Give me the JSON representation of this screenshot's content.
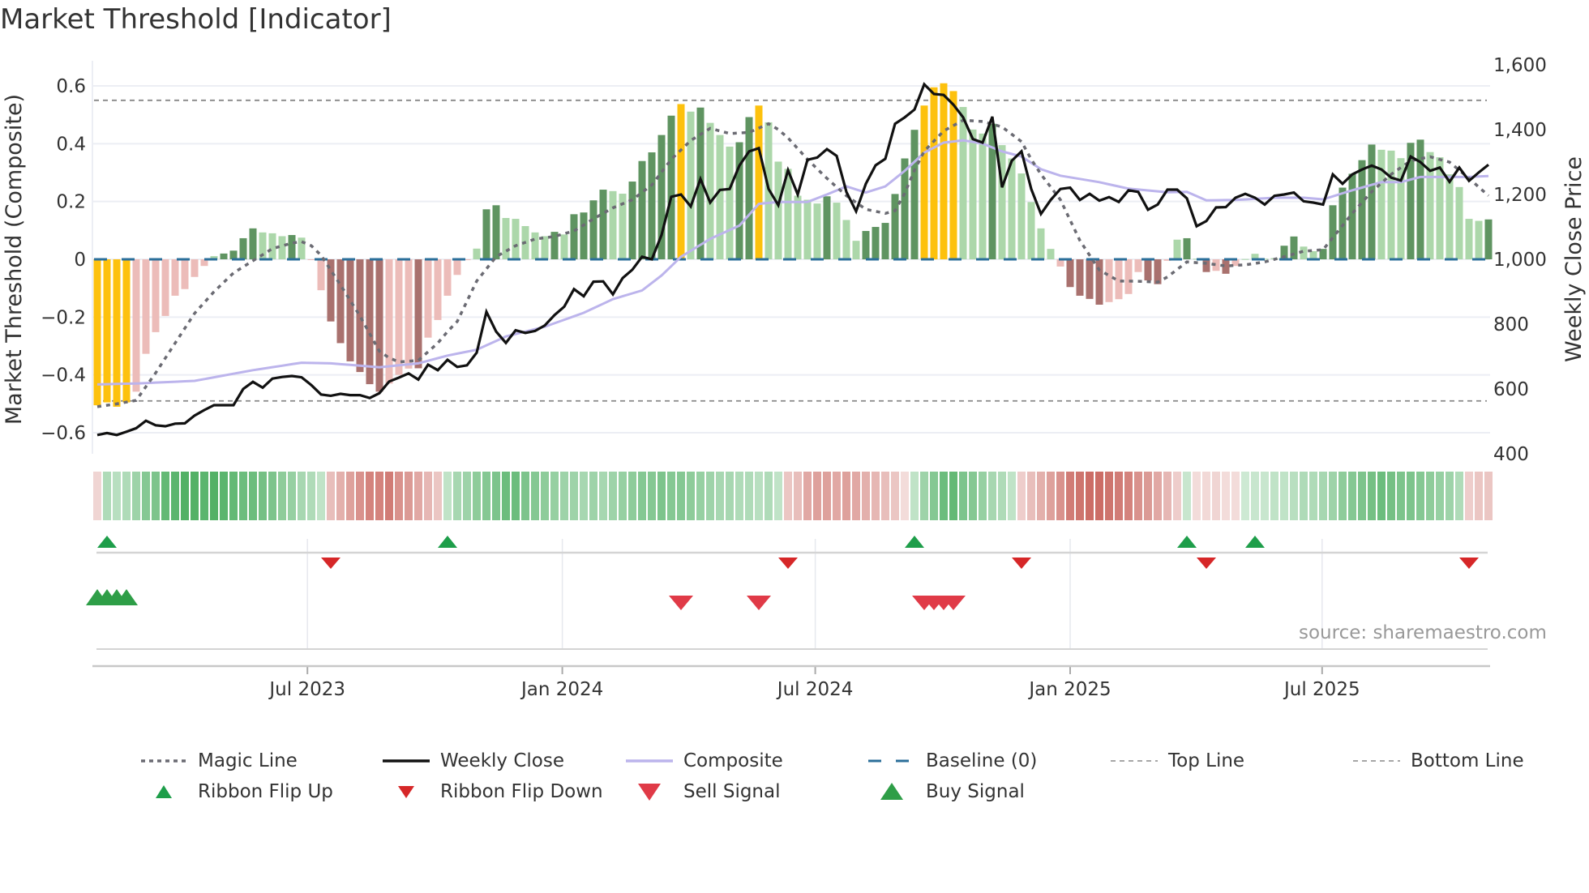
{
  "title": "Market Threshold [Indicator]",
  "source": "source: sharemaestro.com",
  "legend": [
    {
      "label": "Magic Line",
      "symbol": "dotted-line",
      "color": "#6b6b73"
    },
    {
      "label": "Weekly Close",
      "symbol": "solid-line",
      "color": "#111111"
    },
    {
      "label": "Composite",
      "symbol": "solid-line",
      "color": "#bcb4ec"
    },
    {
      "label": "Baseline (0)",
      "symbol": "dashed-line",
      "color": "#2b6f9a"
    },
    {
      "label": "Top Line",
      "symbol": "thin-dashed-line",
      "color": "#888888"
    },
    {
      "label": "Bottom Line",
      "symbol": "thin-dashed-line",
      "color": "#888888"
    },
    {
      "label": "Ribbon Flip Up",
      "symbol": "triangle-up",
      "color": "#1e9e4a"
    },
    {
      "label": "Ribbon Flip Down",
      "symbol": "triangle-down",
      "color": "#d62728"
    },
    {
      "label": "Sell Signal",
      "symbol": "triangle-down-large",
      "color": "#e03a47"
    },
    {
      "label": "Buy Signal",
      "symbol": "triangle-up-large",
      "color": "#2e9e47"
    }
  ],
  "chart_data": {
    "type": "bar",
    "title": "Market Threshold [Indicator]",
    "ylabel": "Market Threshold (Composite)",
    "y2label": "Weekly Close Price",
    "ylim": [
      -0.66,
      0.7
    ],
    "y2lim": [
      400,
      1600
    ],
    "yticks": [
      -0.6,
      -0.4,
      -0.2,
      0,
      0.2,
      0.4,
      0.6
    ],
    "ytick_labels": [
      "−0.6",
      "−0.4",
      "−0.2",
      "0",
      "0.2",
      "0.4",
      "0.6"
    ],
    "y2ticks": [
      400,
      600,
      800,
      1000,
      1200,
      1400,
      1600
    ],
    "y2tick_labels": [
      "400",
      "600",
      "800",
      "1,000",
      "1,200",
      "1,400",
      "1,600"
    ],
    "xticks": [
      {
        "label": "Jul 2023",
        "week_index": 21.6
      },
      {
        "label": "Jan 2024",
        "week_index": 47.8
      },
      {
        "label": "Jul 2024",
        "week_index": 73.8
      },
      {
        "label": "Jan 2025",
        "week_index": 100.0
      },
      {
        "label": "Jul 2025",
        "week_index": 125.9
      }
    ],
    "grid": true,
    "legend_position": "bottom",
    "top_line": 0.55,
    "bottom_line": -0.49,
    "baseline": 0,
    "colors": {
      "Y": "#fdc10d",
      "DG": "#5f9461",
      "LG": "#acd7aa",
      "DR": "#a9716e",
      "LR": "#ecbcb9",
      "ribbon_pos": "#3aa650",
      "ribbon_neg": "#c4574f"
    },
    "composite_bars": [
      -0.505,
      -0.495,
      -0.51,
      -0.495,
      -0.458,
      -0.327,
      -0.252,
      -0.196,
      -0.126,
      -0.103,
      -0.061,
      -0.023,
      0.011,
      0.02,
      0.03,
      0.073,
      0.107,
      0.093,
      0.09,
      0.08,
      0.084,
      0.075,
      -0.002,
      -0.107,
      -0.215,
      -0.29,
      -0.353,
      -0.39,
      -0.432,
      -0.458,
      -0.43,
      -0.4,
      -0.378,
      -0.377,
      -0.271,
      -0.21,
      -0.126,
      -0.054,
      -0.003,
      0.037,
      0.173,
      0.187,
      0.143,
      0.14,
      0.115,
      0.093,
      0.08,
      0.095,
      0.086,
      0.156,
      0.162,
      0.204,
      0.241,
      0.236,
      0.227,
      0.269,
      0.34,
      0.37,
      0.43,
      0.497,
      0.537,
      0.511,
      0.525,
      0.472,
      0.43,
      0.39,
      0.405,
      0.492,
      0.532,
      0.474,
      0.338,
      0.313,
      0.22,
      0.206,
      0.193,
      0.218,
      0.196,
      0.136,
      0.064,
      0.098,
      0.112,
      0.126,
      0.226,
      0.349,
      0.448,
      0.532,
      0.595,
      0.609,
      0.582,
      0.527,
      0.449,
      0.435,
      0.469,
      0.395,
      0.349,
      0.297,
      0.198,
      0.107,
      0.036,
      -0.025,
      -0.096,
      -0.126,
      -0.137,
      -0.157,
      -0.148,
      -0.138,
      -0.12,
      -0.044,
      -0.073,
      -0.086,
      -0.005,
      0.068,
      0.073,
      0.002,
      -0.044,
      -0.04,
      -0.05,
      -0.023,
      0.001,
      0.019,
      0.002,
      0.004,
      0.047,
      0.079,
      0.044,
      0.028,
      0.036,
      0.187,
      0.248,
      0.296,
      0.343,
      0.397,
      0.379,
      0.376,
      0.35,
      0.403,
      0.414,
      0.371,
      0.353,
      0.294,
      0.25,
      0.14,
      0.133,
      0.138
    ],
    "bar_classes": [
      "Y",
      "Y",
      "Y",
      "Y",
      "LR",
      "LR",
      "LR",
      "LR",
      "LR",
      "LR",
      "LR",
      "LR",
      "LG",
      "DG",
      "DG",
      "DG",
      "DG",
      "LG",
      "LG",
      "LG",
      "DG",
      "LG",
      "LR",
      "LR",
      "DR",
      "DR",
      "DR",
      "DR",
      "DR",
      "DR",
      "LR",
      "LR",
      "LR",
      "DR",
      "LR",
      "LR",
      "LR",
      "LR",
      "LR",
      "LG",
      "DG",
      "DG",
      "LG",
      "LG",
      "LG",
      "LG",
      "LG",
      "DG",
      "LG",
      "DG",
      "DG",
      "DG",
      "DG",
      "LG",
      "LG",
      "DG",
      "DG",
      "DG",
      "DG",
      "DG",
      "Y",
      "LG",
      "DG",
      "LG",
      "LG",
      "LG",
      "DG",
      "DG",
      "Y",
      "LG",
      "LG",
      "LG",
      "LG",
      "LG",
      "LG",
      "DG",
      "LG",
      "LG",
      "LG",
      "DG",
      "DG",
      "DG",
      "DG",
      "DG",
      "DG",
      "Y",
      "Y",
      "Y",
      "Y",
      "LG",
      "LG",
      "LG",
      "DG",
      "LG",
      "LG",
      "LG",
      "LG",
      "LG",
      "LG",
      "LR",
      "DR",
      "DR",
      "DR",
      "DR",
      "LR",
      "LR",
      "LR",
      "LR",
      "DR",
      "DR",
      "LR",
      "LG",
      "DG",
      "LG",
      "DR",
      "LR",
      "DR",
      "LR",
      "LG",
      "LG",
      "LG",
      "LG",
      "DG",
      "DG",
      "LG",
      "LG",
      "DG",
      "DG",
      "DG",
      "DG",
      "DG",
      "DG",
      "LG",
      "LG",
      "LG",
      "DG",
      "DG",
      "LG",
      "LG",
      "LG",
      "LG",
      "LG",
      "LG",
      "DG"
    ],
    "weekly_close": [
      458,
      464,
      458,
      468,
      479,
      502,
      488,
      485,
      493,
      494,
      518,
      535,
      550,
      550,
      550,
      600,
      622,
      604,
      632,
      637,
      640,
      636,
      612,
      583,
      579,
      585,
      581,
      581,
      572,
      587,
      623,
      635,
      648,
      629,
      675,
      658,
      690,
      668,
      673,
      712,
      838,
      777,
      742,
      781,
      773,
      779,
      796,
      828,
      854,
      908,
      886,
      931,
      932,
      892,
      942,
      968,
      1008,
      1000,
      1075,
      1193,
      1200,
      1163,
      1248,
      1175,
      1214,
      1217,
      1289,
      1333,
      1343,
      1217,
      1167,
      1275,
      1200,
      1307,
      1314,
      1340,
      1319,
      1208,
      1148,
      1233,
      1290,
      1310,
      1418,
      1438,
      1462,
      1540,
      1510,
      1507,
      1477,
      1438,
      1371,
      1360,
      1440,
      1222,
      1304,
      1333,
      1217,
      1140,
      1183,
      1217,
      1221,
      1183,
      1202,
      1181,
      1192,
      1177,
      1213,
      1208,
      1153,
      1169,
      1215,
      1215,
      1188,
      1102,
      1118,
      1160,
      1161,
      1190,
      1202,
      1190,
      1169,
      1196,
      1200,
      1206,
      1179,
      1175,
      1169,
      1262,
      1233,
      1262,
      1277,
      1289,
      1277,
      1252,
      1243,
      1317,
      1300,
      1273,
      1283,
      1239,
      1283,
      1242,
      1268,
      1292
    ],
    "composite_line": [
      [
        0,
        614
      ],
      [
        4,
        617
      ],
      [
        10,
        625
      ],
      [
        16,
        658
      ],
      [
        21,
        681
      ],
      [
        24,
        679
      ],
      [
        29,
        667
      ],
      [
        33,
        679
      ],
      [
        36,
        703
      ],
      [
        39,
        721
      ],
      [
        42,
        762
      ],
      [
        46,
        792
      ],
      [
        50,
        835
      ],
      [
        53,
        877
      ],
      [
        56,
        904
      ],
      [
        58,
        950
      ],
      [
        60,
        1008
      ],
      [
        63,
        1063
      ],
      [
        66,
        1104
      ],
      [
        68,
        1171
      ],
      [
        70,
        1177
      ],
      [
        73,
        1177
      ],
      [
        75,
        1200
      ],
      [
        77,
        1225
      ],
      [
        79,
        1206
      ],
      [
        81,
        1225
      ],
      [
        83,
        1273
      ],
      [
        85,
        1329
      ],
      [
        87,
        1360
      ],
      [
        89,
        1367
      ],
      [
        91,
        1357
      ],
      [
        93,
        1333
      ],
      [
        95,
        1317
      ],
      [
        97,
        1278
      ],
      [
        99,
        1258
      ],
      [
        103,
        1238
      ],
      [
        106,
        1218
      ],
      [
        110,
        1207
      ],
      [
        112,
        1208
      ],
      [
        114,
        1182
      ],
      [
        117,
        1183
      ],
      [
        121,
        1190
      ],
      [
        124,
        1190
      ],
      [
        126,
        1185
      ],
      [
        129,
        1213
      ],
      [
        132,
        1238
      ],
      [
        134,
        1238
      ],
      [
        136,
        1254
      ],
      [
        139,
        1254
      ],
      [
        141,
        1254
      ],
      [
        143,
        1257
      ]
    ],
    "magic_line": [
      [
        0,
        -0.51
      ],
      [
        2,
        -0.5
      ],
      [
        4,
        -0.488
      ],
      [
        6,
        -0.393
      ],
      [
        8,
        -0.29
      ],
      [
        10,
        -0.187
      ],
      [
        12,
        -0.112
      ],
      [
        14,
        -0.047
      ],
      [
        16,
        -0.005
      ],
      [
        18,
        0.037
      ],
      [
        20,
        0.056
      ],
      [
        21,
        0.061
      ],
      [
        22,
        0.047
      ],
      [
        23,
        0.014
      ],
      [
        25,
        -0.089
      ],
      [
        27,
        -0.196
      ],
      [
        29,
        -0.318
      ],
      [
        30,
        -0.341
      ],
      [
        31,
        -0.355
      ],
      [
        33,
        -0.35
      ],
      [
        35,
        -0.29
      ],
      [
        36,
        -0.25
      ],
      [
        37,
        -0.215
      ],
      [
        39,
        -0.075
      ],
      [
        41,
        0.009
      ],
      [
        43,
        0.047
      ],
      [
        45,
        0.07
      ],
      [
        47,
        0.079
      ],
      [
        49,
        0.098
      ],
      [
        51,
        0.14
      ],
      [
        53,
        0.178
      ],
      [
        55,
        0.206
      ],
      [
        57,
        0.257
      ],
      [
        59,
        0.346
      ],
      [
        61,
        0.411
      ],
      [
        63,
        0.453
      ],
      [
        65,
        0.435
      ],
      [
        67,
        0.439
      ],
      [
        69,
        0.469
      ],
      [
        70,
        0.449
      ],
      [
        71,
        0.42
      ],
      [
        73,
        0.346
      ],
      [
        75,
        0.28
      ],
      [
        77,
        0.22
      ],
      [
        79,
        0.173
      ],
      [
        81,
        0.159
      ],
      [
        82,
        0.168
      ],
      [
        83,
        0.229
      ],
      [
        84,
        0.308
      ],
      [
        85,
        0.374
      ],
      [
        87,
        0.444
      ],
      [
        89,
        0.481
      ],
      [
        91,
        0.477
      ],
      [
        93,
        0.458
      ],
      [
        95,
        0.407
      ],
      [
        96,
        0.346
      ],
      [
        97,
        0.294
      ],
      [
        99,
        0.206
      ],
      [
        101,
        0.065
      ],
      [
        103,
        -0.037
      ],
      [
        105,
        -0.075
      ],
      [
        107,
        -0.076
      ],
      [
        109,
        -0.079
      ],
      [
        110,
        -0.061
      ],
      [
        112,
        -0.009
      ],
      [
        114,
        -0.014
      ],
      [
        116,
        -0.023
      ],
      [
        118,
        -0.019
      ],
      [
        120,
        -0.009
      ],
      [
        122,
        0.009
      ],
      [
        124,
        0.028
      ],
      [
        126,
        0.033
      ],
      [
        127,
        0.075
      ],
      [
        129,
        0.159
      ],
      [
        131,
        0.234
      ],
      [
        133,
        0.294
      ],
      [
        135,
        0.341
      ],
      [
        137,
        0.355
      ],
      [
        139,
        0.336
      ],
      [
        141,
        0.28
      ],
      [
        143,
        0.22
      ]
    ],
    "ribbon": [
      -0.15,
      0.3,
      0.25,
      0.3,
      0.4,
      0.55,
      0.6,
      0.75,
      0.8,
      0.85,
      0.85,
      0.8,
      0.85,
      0.8,
      0.75,
      0.7,
      0.7,
      0.65,
      0.6,
      0.5,
      0.45,
      0.35,
      0.3,
      0.2,
      -0.3,
      -0.4,
      -0.5,
      -0.6,
      -0.7,
      -0.7,
      -0.75,
      -0.6,
      -0.55,
      -0.45,
      -0.35,
      -0.25,
      0.2,
      0.35,
      0.4,
      0.5,
      0.55,
      0.6,
      0.7,
      0.7,
      0.6,
      0.55,
      0.5,
      0.45,
      0.4,
      0.4,
      0.35,
      0.4,
      0.35,
      0.4,
      0.45,
      0.5,
      0.55,
      0.55,
      0.6,
      0.55,
      0.55,
      0.5,
      0.45,
      0.4,
      0.35,
      0.35,
      0.3,
      0.3,
      0.25,
      0.3,
      0.2,
      -0.25,
      -0.3,
      -0.45,
      -0.5,
      -0.5,
      -0.45,
      -0.5,
      -0.45,
      -0.4,
      -0.35,
      -0.3,
      -0.25,
      -0.1,
      0.2,
      0.4,
      0.55,
      0.7,
      0.75,
      0.6,
      0.55,
      0.45,
      0.35,
      0.3,
      0.2,
      -0.2,
      -0.3,
      -0.4,
      -0.5,
      -0.6,
      -0.75,
      -0.8,
      -0.85,
      -0.85,
      -0.8,
      -0.75,
      -0.7,
      -0.6,
      -0.55,
      -0.45,
      -0.35,
      -0.2,
      0.15,
      -0.1,
      -0.12,
      -0.15,
      -0.1,
      -0.1,
      0.12,
      0.15,
      0.15,
      0.2,
      0.2,
      0.25,
      0.3,
      0.3,
      0.35,
      0.4,
      0.5,
      0.55,
      0.6,
      0.65,
      0.7,
      0.65,
      0.6,
      0.6,
      0.55,
      0.5,
      0.45,
      0.4,
      0.3,
      -0.2,
      -0.25,
      -0.25
    ],
    "ribbon_flip_up": [
      1,
      36,
      84,
      112,
      119
    ],
    "ribbon_flip_down": [
      24,
      71,
      95,
      114,
      141
    ],
    "buy_signals": [
      0,
      1,
      2,
      3
    ],
    "sell_signals": [
      60,
      68,
      85,
      86,
      87,
      88
    ]
  }
}
